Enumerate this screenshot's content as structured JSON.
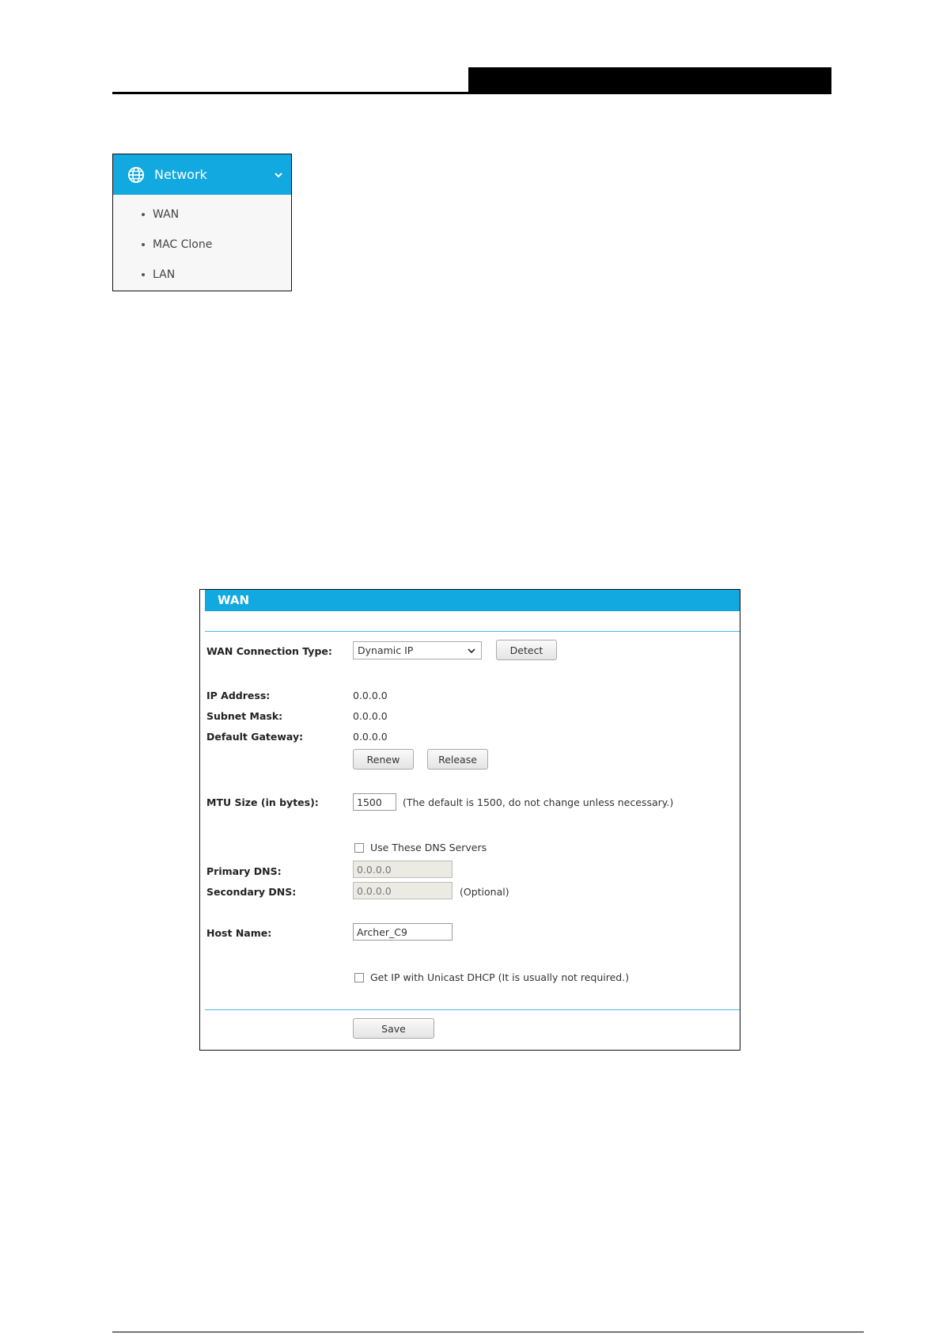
{
  "menu": {
    "title": "Network",
    "items": [
      {
        "label": "WAN"
      },
      {
        "label": "MAC Clone"
      },
      {
        "label": "LAN"
      }
    ]
  },
  "wan": {
    "title": "WAN",
    "connection_type_label": "WAN Connection Type:",
    "connection_type_value": "Dynamic IP",
    "detect_label": "Detect",
    "ip_address_label": "IP Address:",
    "ip_address_value": "0.0.0.0",
    "subnet_mask_label": "Subnet Mask:",
    "subnet_mask_value": "0.0.0.0",
    "default_gateway_label": "Default Gateway:",
    "default_gateway_value": "0.0.0.0",
    "renew_label": "Renew",
    "release_label": "Release",
    "mtu_label": "MTU Size (in bytes):",
    "mtu_value": "1500",
    "mtu_note": "(The default is 1500, do not change unless necessary.)",
    "use_dns_label": "Use These DNS Servers",
    "use_dns_checked": false,
    "primary_dns_label": "Primary DNS:",
    "primary_dns_value": "0.0.0.0",
    "secondary_dns_label": "Secondary DNS:",
    "secondary_dns_value": "0.0.0.0",
    "secondary_dns_note": "(Optional)",
    "host_name_label": "Host Name:",
    "host_name_value": "Archer_C9",
    "unicast_label": "Get IP with Unicast DHCP (It is usually not required.)",
    "unicast_checked": false,
    "save_label": "Save"
  },
  "colors": {
    "accent": "#12a9e0",
    "rule": "#4cb8e6"
  }
}
